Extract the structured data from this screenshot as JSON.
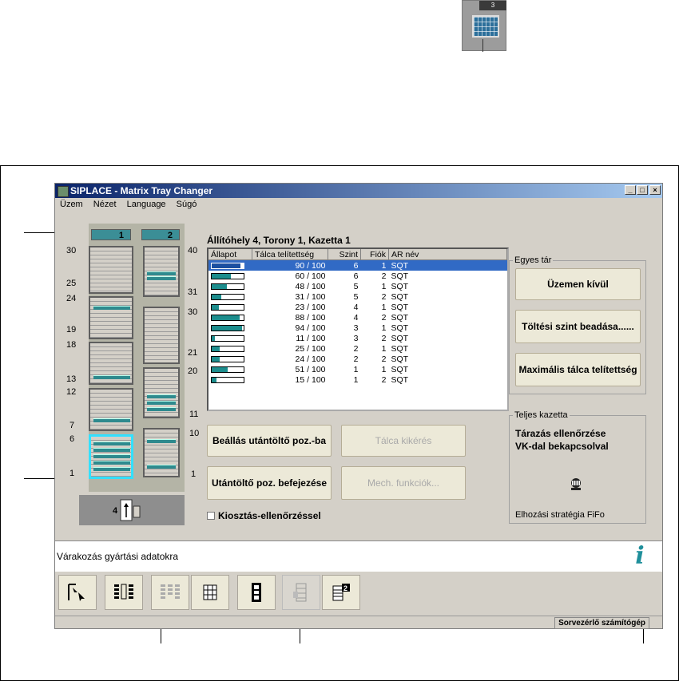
{
  "top_icon": {
    "number": "3"
  },
  "window": {
    "title": "SIPLACE - Matrix Tray Changer",
    "menu": [
      "Üzem",
      "Nézet",
      "Language",
      "Súgó"
    ]
  },
  "tower": {
    "columns": [
      {
        "label": "1"
      },
      {
        "label": "2"
      }
    ],
    "levels_left": [
      "30",
      "25",
      "24",
      "19",
      "18",
      "13",
      "12",
      "7",
      "6",
      "1"
    ],
    "levels_right": [
      "40",
      "31",
      "30",
      "21",
      "20",
      "11",
      "10",
      "1"
    ],
    "bottom_number": "4"
  },
  "table": {
    "title": "Állítóhely 4, Torony 1, Kazetta 1",
    "headers": [
      "Állapot",
      "Tálca telítettség",
      "Szint",
      "Fiók",
      "AR név"
    ],
    "rows": [
      {
        "fill": 90,
        "value": "90 / 100",
        "level": "6",
        "drawer": "1",
        "name": "SQT",
        "selected": true
      },
      {
        "fill": 60,
        "value": "60 / 100",
        "level": "6",
        "drawer": "2",
        "name": "SQT"
      },
      {
        "fill": 48,
        "value": "48 / 100",
        "level": "5",
        "drawer": "1",
        "name": "SQT"
      },
      {
        "fill": 31,
        "value": "31 / 100",
        "level": "5",
        "drawer": "2",
        "name": "SQT"
      },
      {
        "fill": 23,
        "value": "23 / 100",
        "level": "4",
        "drawer": "1",
        "name": "SQT"
      },
      {
        "fill": 88,
        "value": "88 / 100",
        "level": "4",
        "drawer": "2",
        "name": "SQT"
      },
      {
        "fill": 94,
        "value": "94 / 100",
        "level": "3",
        "drawer": "1",
        "name": "SQT"
      },
      {
        "fill": 11,
        "value": "11 / 100",
        "level": "3",
        "drawer": "2",
        "name": "SQT"
      },
      {
        "fill": 25,
        "value": "25 / 100",
        "level": "2",
        "drawer": "1",
        "name": "SQT"
      },
      {
        "fill": 24,
        "value": "24 / 100",
        "level": "2",
        "drawer": "2",
        "name": "SQT"
      },
      {
        "fill": 51,
        "value": "51 / 100",
        "level": "1",
        "drawer": "1",
        "name": "SQT"
      },
      {
        "fill": 15,
        "value": "15 / 100",
        "level": "1",
        "drawer": "2",
        "name": "SQT"
      }
    ]
  },
  "buttons": {
    "set_refill": "Beállás utántöltő poz.-ba",
    "tray_request": "Tálca kikérés",
    "finish_refill": "Utántöltő poz. befejezése",
    "mech_functions": "Mech. funkciók..."
  },
  "checkbox": {
    "label": "Kiosztás-ellenőrzéssel"
  },
  "single_tray": {
    "group_label": "Egyes tár",
    "out_of_service": "Üzemen kívül",
    "fill_level": "Töltési szint beadása......",
    "max_fill": "Maximális tálca telítettség"
  },
  "full_cassette": {
    "group_label": "Teljes kazetta",
    "line1": "Tárazás ellenőrzése",
    "line2": "VK-dal bekapcsolval",
    "strategy": "Elhozási stratégia FiFo"
  },
  "message": "Várakozás gyártási adatokra",
  "status": {
    "pane": "Sorvezérlő számítógép"
  },
  "colors": {
    "accent": "#3b8e96",
    "selection": "#316ac5",
    "title_start": "#0a246a"
  }
}
